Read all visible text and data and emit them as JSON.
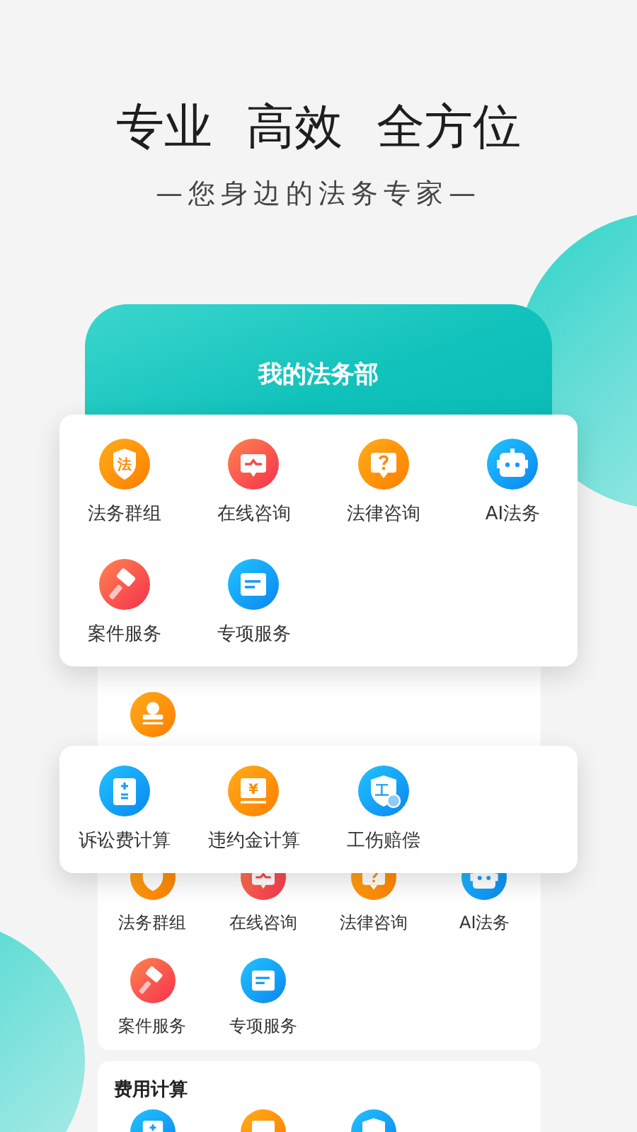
{
  "headline": [
    "专业",
    "高效",
    "全方位"
  ],
  "tagline": "—您身边的法务专家—",
  "phone": {
    "title": "我的法务部",
    "services": [
      {
        "label": "法务群组"
      },
      {
        "label": "在线咨询"
      },
      {
        "label": "法律咨询"
      },
      {
        "label": "AI法务"
      },
      {
        "label": "案件服务"
      },
      {
        "label": "专项服务"
      }
    ],
    "fee_title": "费用计算"
  },
  "overlay_services": [
    {
      "label": "法务群组",
      "icon_text": "法"
    },
    {
      "label": "在线咨询"
    },
    {
      "label": "法律咨询"
    },
    {
      "label": "AI法务"
    },
    {
      "label": "案件服务"
    },
    {
      "label": "专项服务"
    }
  ],
  "overlay_calculators": [
    {
      "label": "诉讼费计算"
    },
    {
      "label": "违约金计算",
      "icon_text": "¥"
    },
    {
      "label": "工伤赔偿",
      "icon_text": "工"
    }
  ]
}
